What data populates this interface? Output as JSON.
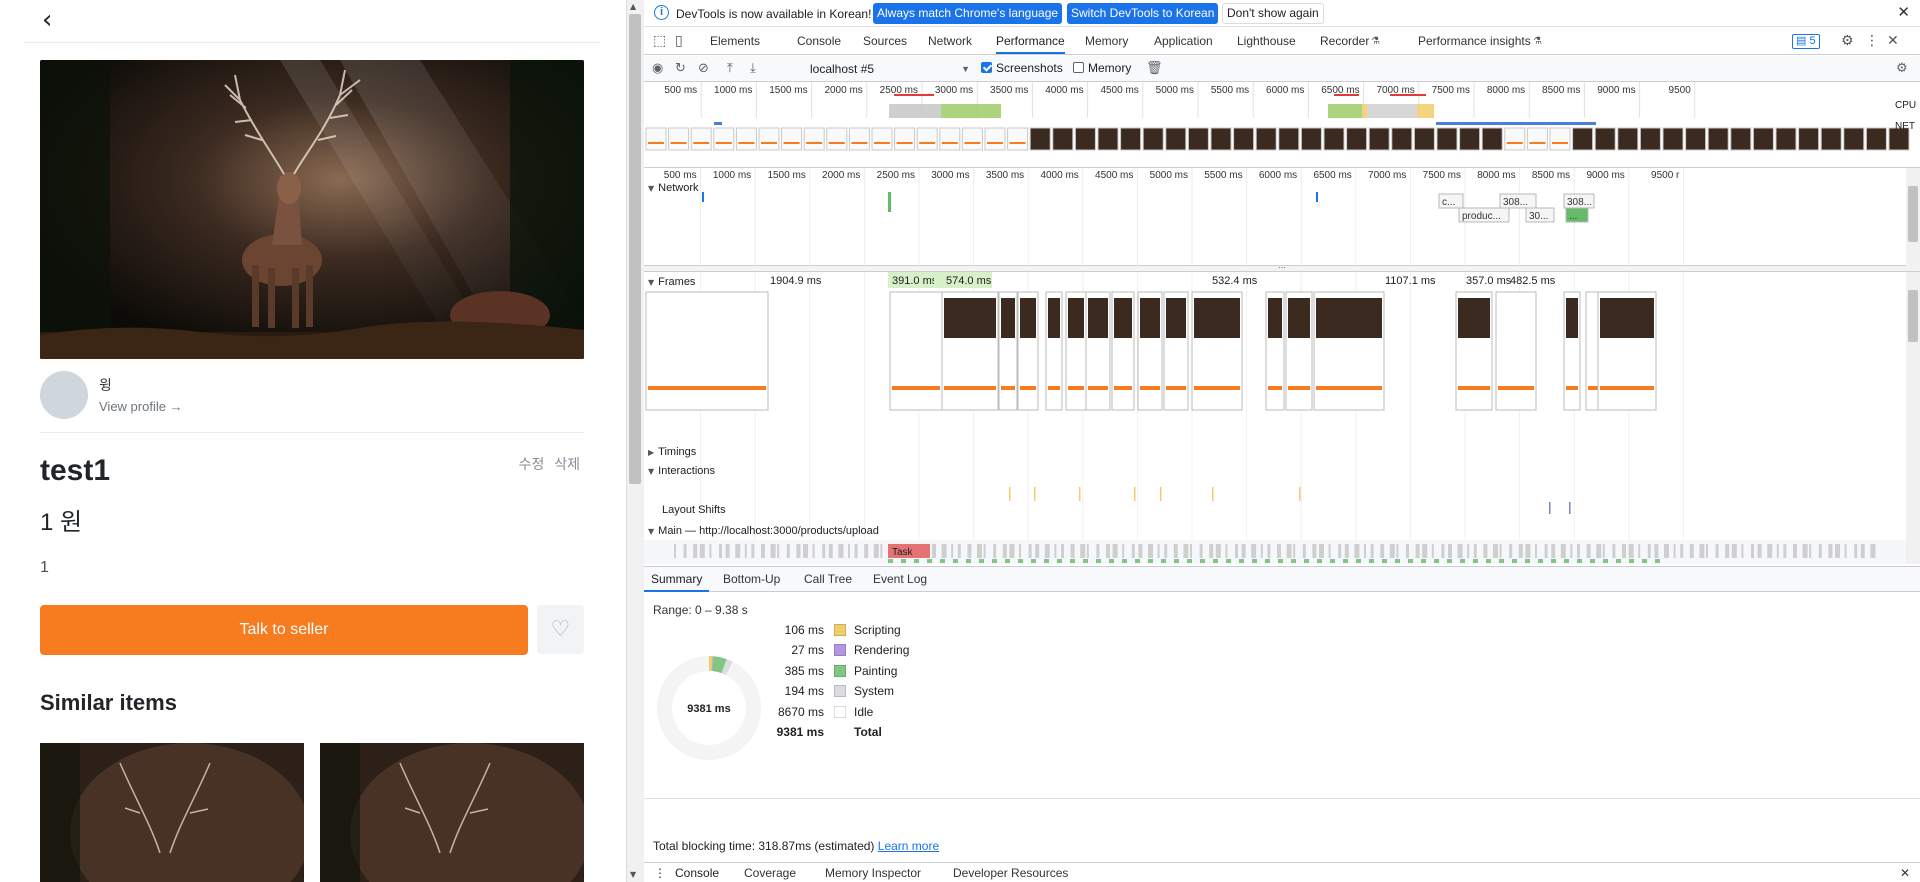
{
  "app": {
    "back_glyph": "‹",
    "seller": {
      "name": "윙",
      "profile_link": "View profile →"
    },
    "product": {
      "title": "test1",
      "price": "1 원",
      "description": "1"
    },
    "owner_actions": {
      "edit": "수정",
      "delete": "삭제"
    },
    "cta": "Talk to seller",
    "like_glyph": "♡",
    "similar_heading": "Similar items"
  },
  "devtools": {
    "infobar": {
      "message": "DevTools is now available in Korean!",
      "btn_match": "Always match Chrome's language",
      "btn_switch": "Switch DevTools to Korean",
      "btn_dismiss": "Don't show again"
    },
    "tabs": [
      "Elements",
      "Console",
      "Sources",
      "Network",
      "Performance",
      "Memory",
      "Application",
      "Lighthouse",
      "Recorder",
      "Performance insights"
    ],
    "active_tab": "Performance",
    "issues_count": "5",
    "toolbar": {
      "target": "localhost #5",
      "screenshots_label": "Screenshots",
      "screenshots_checked": true,
      "memory_label": "Memory",
      "memory_checked": false
    },
    "overview_ticks": [
      "500 ms",
      "1000 ms",
      "1500 ms",
      "2000 ms",
      "2500 ms",
      "3000 ms",
      "3500 ms",
      "4000 ms",
      "4500 ms",
      "5000 ms",
      "5500 ms",
      "6000 ms",
      "6500 ms",
      "7000 ms",
      "7500 ms",
      "8000 ms",
      "8500 ms",
      "9000 ms",
      "9500"
    ],
    "overview_labels": {
      "cpu": "CPU",
      "net": "NET"
    },
    "main_ticks": [
      "500 ms",
      "1000 ms",
      "1500 ms",
      "2000 ms",
      "2500 ms",
      "3000 ms",
      "3500 ms",
      "4000 ms",
      "4500 ms",
      "5000 ms",
      "5500 ms",
      "6000 ms",
      "6500 ms",
      "7000 ms",
      "7500 ms",
      "8000 ms",
      "8500 ms",
      "9000 ms",
      "9500 r"
    ],
    "network_track": {
      "label": "Network",
      "requests": [
        "c...",
        "308...",
        "308...",
        "produc...",
        "30...",
        "..."
      ]
    },
    "frames_track": {
      "label": "Frames",
      "durations": [
        "1904.9 ms",
        "391.0 ms",
        "574.0 ms",
        "532.4 ms",
        "1107.1 ms",
        "357.0 ms",
        "482.5 ms"
      ]
    },
    "tracks": {
      "timings": "Timings",
      "interactions": "Interactions",
      "layout_shifts": "Layout Shifts",
      "main": "Main — http://localhost:3000/products/upload",
      "task": "Task"
    },
    "bottom_tabs": [
      "Summary",
      "Bottom-Up",
      "Call Tree",
      "Event Log"
    ],
    "active_bottom_tab": "Summary",
    "summary": {
      "range": "Range: 0 – 9.38 s",
      "center": "9381 ms",
      "rows": [
        {
          "value": "106 ms",
          "label": "Scripting",
          "color": "#f2cd6b",
          "ms": 106
        },
        {
          "value": "27 ms",
          "label": "Rendering",
          "color": "#b197e3",
          "ms": 27
        },
        {
          "value": "385 ms",
          "label": "Painting",
          "color": "#81c784",
          "ms": 385
        },
        {
          "value": "194 ms",
          "label": "System",
          "color": "#dadce0",
          "ms": 194
        },
        {
          "value": "8670 ms",
          "label": "Idle",
          "color": "#ffffff",
          "ms": 8670
        }
      ],
      "total": {
        "value": "9381 ms",
        "label": "Total"
      },
      "tbt": "Total blocking time: 318.87ms (estimated)",
      "learn_more": "Learn more"
    },
    "drawer_tabs": [
      "Console",
      "Coverage",
      "Memory Inspector",
      "Developer Resources"
    ]
  }
}
